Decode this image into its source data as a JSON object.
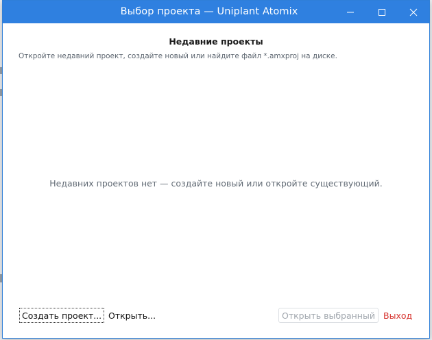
{
  "window": {
    "title": "Выбор проекта — Uniplant Atomix"
  },
  "header": {
    "heading": "Недавние проекты",
    "subtitle": "Откройте недавний проект, создайте новый или найдите файл *.amxproj на диске."
  },
  "recent_projects": {
    "empty_message": "Недавних проектов нет — создайте новый или откройте существующий."
  },
  "footer": {
    "create_label": "Создать проект...",
    "open_label": "Открыть...",
    "open_selected_label": "Открыть выбранный",
    "exit_label": "Выход"
  },
  "colors": {
    "titlebar": "#2f80e0",
    "exit_text": "#d6322d",
    "disabled_text": "#a0a6ad"
  },
  "icons": [
    "minimize-icon",
    "maximize-icon",
    "close-icon"
  ]
}
